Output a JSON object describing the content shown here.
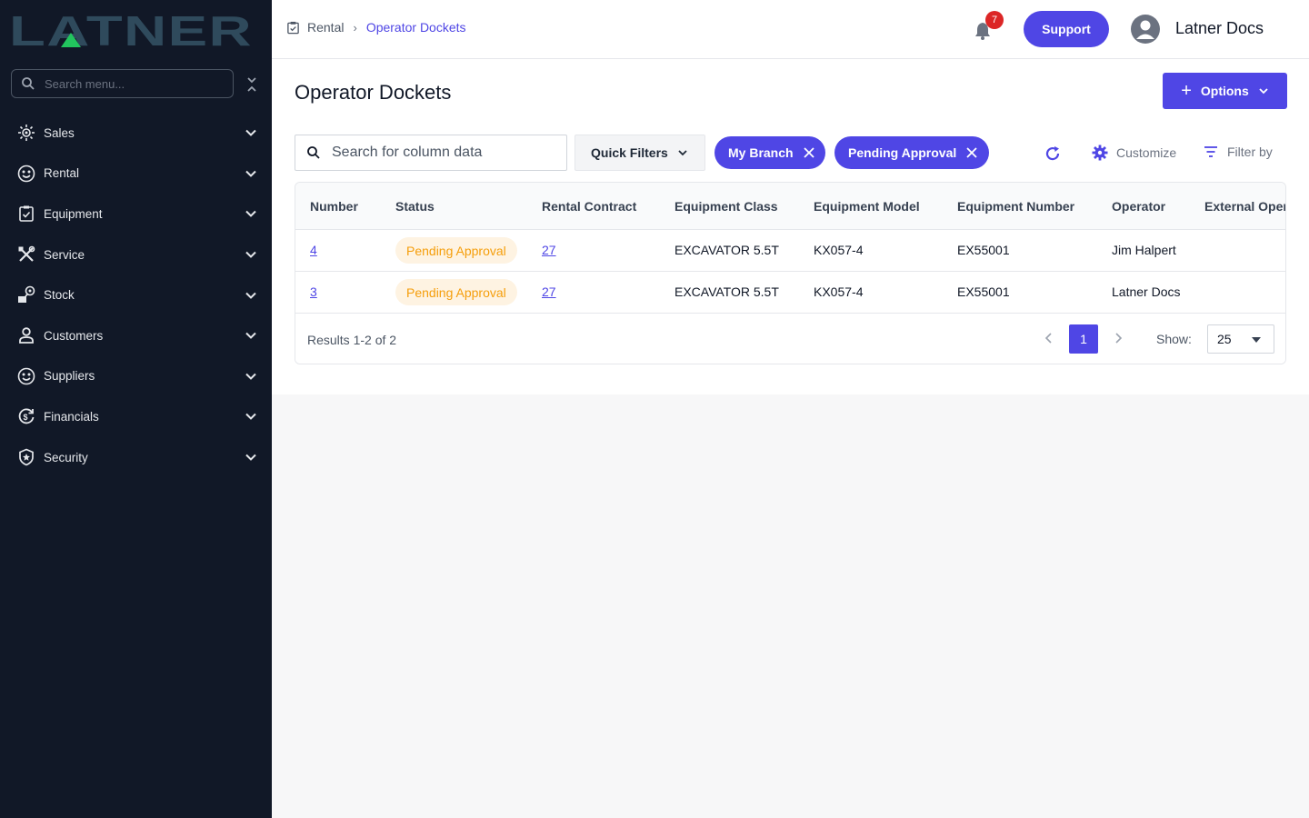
{
  "brand": {
    "logo_text": "LATNER",
    "logo_color": "#2f4a5c",
    "accent_green": "#22c55e"
  },
  "sidebar": {
    "search_placeholder": "Search menu...",
    "items": [
      {
        "label": "Sales",
        "icon": "sales-icon"
      },
      {
        "label": "Rental",
        "icon": "rental-icon"
      },
      {
        "label": "Equipment",
        "icon": "equipment-icon"
      },
      {
        "label": "Service",
        "icon": "service-icon"
      },
      {
        "label": "Stock",
        "icon": "stock-icon"
      },
      {
        "label": "Customers",
        "icon": "customers-icon"
      },
      {
        "label": "Suppliers",
        "icon": "suppliers-icon"
      },
      {
        "label": "Financials",
        "icon": "financials-icon"
      },
      {
        "label": "Security",
        "icon": "security-icon"
      }
    ]
  },
  "header": {
    "breadcrumb": [
      "Rental",
      "Operator Dockets"
    ],
    "notification_count": "7",
    "support_label": "Support",
    "user_name": "Latner Docs"
  },
  "page": {
    "title": "Operator Dockets",
    "options_label": "Options"
  },
  "toolbar": {
    "search_placeholder": "Search for column data",
    "quick_filters_label": "Quick Filters",
    "chips": [
      "My Branch",
      "Pending Approval"
    ],
    "customize_label": "Customize",
    "filter_label": "Filter by"
  },
  "table": {
    "columns": [
      "Number",
      "Status",
      "Rental Contract",
      "Equipment Class",
      "Equipment Model",
      "Equipment Number",
      "Operator",
      "External Oper"
    ],
    "rows": [
      {
        "number": "4",
        "status": "Pending Approval",
        "contract": "27",
        "eq_class": "EXCAVATOR 5.5T",
        "eq_model": "KX057-4",
        "eq_number": "EX55001",
        "operator": "Jim Halpert"
      },
      {
        "number": "3",
        "status": "Pending Approval",
        "contract": "27",
        "eq_class": "EXCAVATOR 5.5T",
        "eq_model": "KX057-4",
        "eq_number": "EX55001",
        "operator": "Latner Docs"
      }
    ],
    "results_text": "Results 1-2 of 2",
    "current_page": "1",
    "show_label": "Show:",
    "page_size": "25"
  },
  "colors": {
    "primary": "#4f46e5",
    "sidebar_bg": "#111827",
    "status_pending_bg": "#fef3e2",
    "status_pending_fg": "#f59e0b",
    "badge": "#dc2626"
  }
}
